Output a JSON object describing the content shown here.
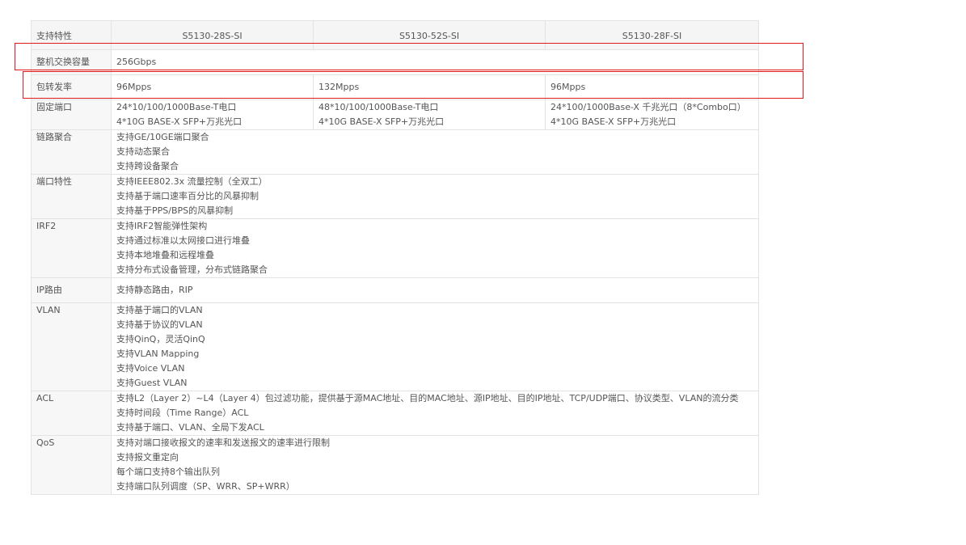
{
  "header": {
    "feature": "支持特性",
    "models": [
      "S5130-28S-SI",
      "S5130-52S-SI",
      "S5130-28F-SI"
    ]
  },
  "rows": {
    "capacity": {
      "label": "整机交换容量",
      "value": "256Gbps"
    },
    "forwarding": {
      "label": "包转发率",
      "values": [
        "96Mpps",
        "132Mpps",
        "96Mpps"
      ]
    },
    "ports": {
      "label": "固定端口",
      "values": [
        [
          "24*10/100/1000Base-T电口",
          "4*10G BASE-X SFP+万兆光口"
        ],
        [
          "48*10/100/1000Base-T电口",
          "4*10G BASE-X SFP+万兆光口"
        ],
        [
          "24*100/1000Base-X 千兆光口（8*Combo口）",
          "4*10G BASE-X SFP+万兆光口"
        ]
      ]
    },
    "aggregation": {
      "label": "链路聚合",
      "lines": [
        "支持GE/10GE端口聚合",
        "支持动态聚合",
        "支持跨设备聚合"
      ]
    },
    "port_features": {
      "label": "端口特性",
      "lines": [
        "支持IEEE802.3x 流量控制（全双工）",
        "支持基于端口速率百分比的风暴抑制",
        "支持基于PPS/BPS的风暴抑制"
      ]
    },
    "irf2": {
      "label": "IRF2",
      "lines": [
        "支持IRF2智能弹性架构",
        "支持通过标准以太网接口进行堆叠",
        "支持本地堆叠和远程堆叠",
        "支持分布式设备管理，分布式链路聚合"
      ]
    },
    "routing": {
      "label": "IP路由",
      "value": "支持静态路由，RIP"
    },
    "vlan": {
      "label": "VLAN",
      "lines": [
        "支持基于端口的VLAN",
        "支持基于协议的VLAN",
        "支持QinQ，灵活QinQ",
        "支持VLAN Mapping",
        "支持Voice VLAN",
        "支持Guest VLAN"
      ]
    },
    "acl": {
      "label": "ACL",
      "lines": [
        "支持L2（Layer 2）~L4（Layer 4）包过滤功能，提供基于源MAC地址、目的MAC地址、源IP地址、目的IP地址、TCP/UDP端口、协议类型、VLAN的流分类",
        "支持时间段（Time Range）ACL",
        "支持基于端口、VLAN、全局下发ACL"
      ]
    },
    "qos": {
      "label": "QoS",
      "lines": [
        "支持对端口接收报文的速率和发送报文的速率进行限制",
        "支持报文重定向",
        "每个端口支持8个输出队列",
        "支持端口队列调度（SP、WRR、SP+WRR）"
      ]
    }
  },
  "highlight_color": "#e0191f"
}
